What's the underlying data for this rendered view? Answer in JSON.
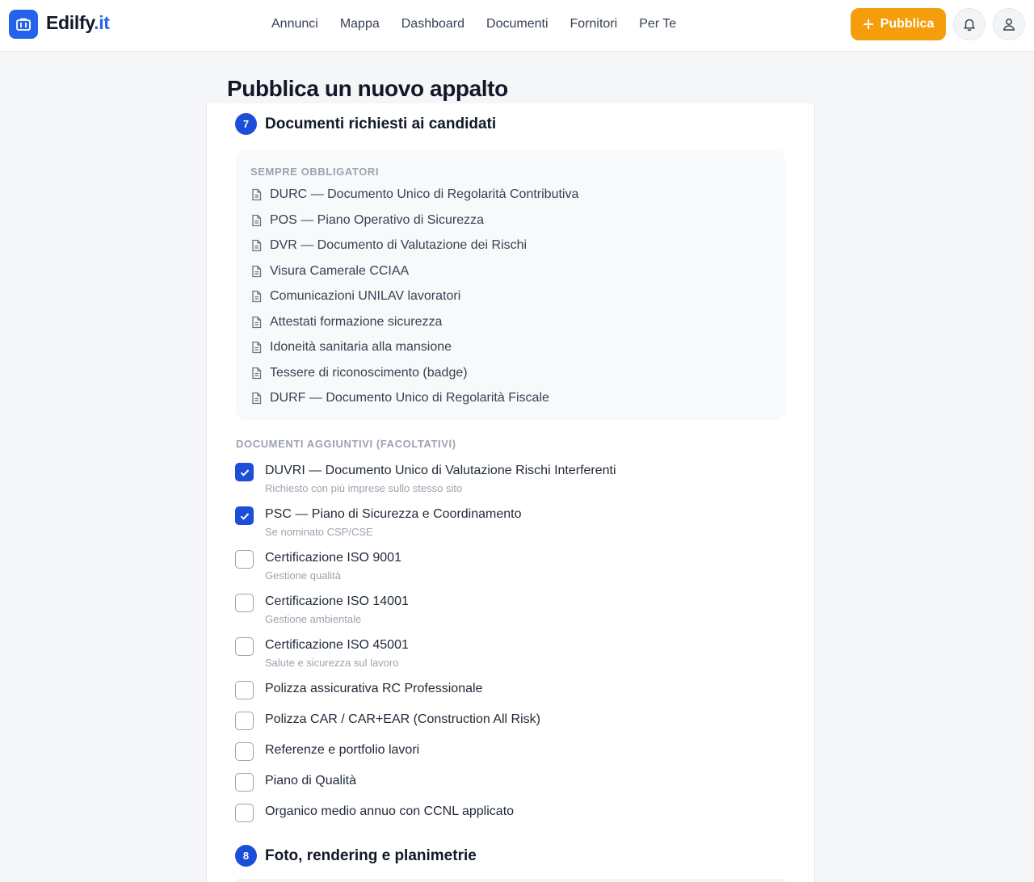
{
  "brand": {
    "name": "Edilfy",
    "tld": ".it",
    "accent": "#2563eb"
  },
  "nav": {
    "links": [
      "Annunci",
      "Mappa",
      "Dashboard",
      "Documenti",
      "Fornitori",
      "Per Te"
    ],
    "publish_label": "Pubblica",
    "publish_color": "#f59e0b"
  },
  "page": {
    "title": "Pubblica un nuovo appalto"
  },
  "step7": {
    "number": "7",
    "title": "Documenti richiesti ai candidati",
    "mandatory_label": "SEMPRE OBBLIGATORI",
    "mandatory_items": [
      "DURC — Documento Unico di Regolarità Contributiva",
      "POS — Piano Operativo di Sicurezza",
      "DVR — Documento di Valutazione dei Rischi",
      "Visura Camerale CCIAA",
      "Comunicazioni UNILAV lavoratori",
      "Attestati formazione sicurezza",
      "Idoneità sanitaria alla mansione",
      "Tessere di riconoscimento (badge)",
      "DURF — Documento Unico di Regolarità Fiscale"
    ],
    "optional_label": "DOCUMENTI AGGIUNTIVI (FACOLTATIVI)",
    "optional_items": [
      {
        "label": "DUVRI — Documento Unico di Valutazione Rischi Interferenti",
        "sub": "Richiesto con più imprese sullo stesso sito",
        "checked": true
      },
      {
        "label": "PSC — Piano di Sicurezza e Coordinamento",
        "sub": "Se nominato CSP/CSE",
        "checked": true
      },
      {
        "label": "Certificazione ISO 9001",
        "sub": "Gestione qualità",
        "checked": false
      },
      {
        "label": "Certificazione ISO 14001",
        "sub": "Gestione ambientale",
        "checked": false
      },
      {
        "label": "Certificazione ISO 45001",
        "sub": "Salute e sicurezza sul lavoro",
        "checked": false
      },
      {
        "label": "Polizza assicurativa RC Professionale",
        "sub": "",
        "checked": false
      },
      {
        "label": "Polizza CAR / CAR+EAR (Construction All Risk)",
        "sub": "",
        "checked": false
      },
      {
        "label": "Referenze e portfolio lavori",
        "sub": "",
        "checked": false
      },
      {
        "label": "Piano di Qualità",
        "sub": "",
        "checked": false
      },
      {
        "label": "Organico medio annuo con CCNL applicato",
        "sub": "",
        "checked": false
      }
    ]
  },
  "step8": {
    "number": "8",
    "title": "Foto, rendering e planimetrie"
  }
}
